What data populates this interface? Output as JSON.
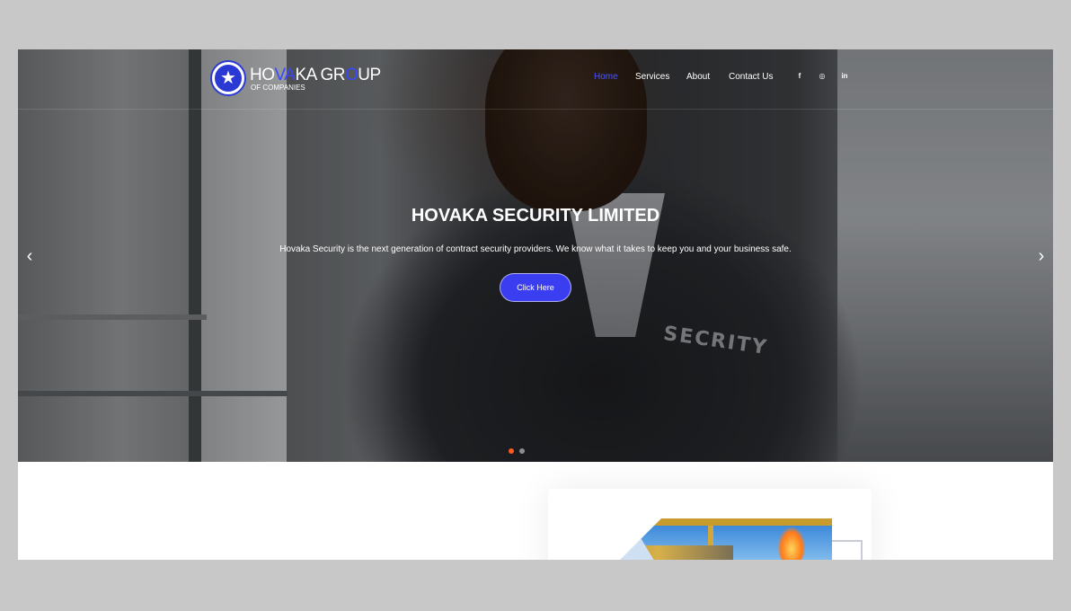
{
  "logo": {
    "name_part1": "HO",
    "name_part2": "VA",
    "name_part3": "KA GR",
    "name_part4": "O",
    "name_part5": "UP",
    "subtitle": "OF COMPANIES",
    "emblem_icon": "star-emblem-icon"
  },
  "nav": {
    "items": [
      {
        "label": "Home",
        "active": true
      },
      {
        "label": "Services",
        "active": false
      },
      {
        "label": "About",
        "active": false
      },
      {
        "label": "Contact Us",
        "active": false
      }
    ],
    "social": [
      {
        "icon": "facebook-icon",
        "glyph": "f"
      },
      {
        "icon": "instagram-icon",
        "glyph": "◎"
      },
      {
        "icon": "linkedin-icon",
        "glyph": "in"
      }
    ]
  },
  "hero": {
    "title": "HOVAKA SECURITY LIMITED",
    "subtitle": "Hovaka Security is the next generation of contract security providers. We know what it takes to keep you and your business safe.",
    "cta_label": "Click Here",
    "patch_text": "SECRITY",
    "prev_glyph": "‹",
    "next_glyph": "›",
    "slides_total": 2,
    "slide_active": 1
  },
  "colors": {
    "accent": "#3a3df0",
    "nav_active": "#4b55ff",
    "dot_active": "#ff5a1f",
    "page_bg": "#c8c8c8"
  }
}
